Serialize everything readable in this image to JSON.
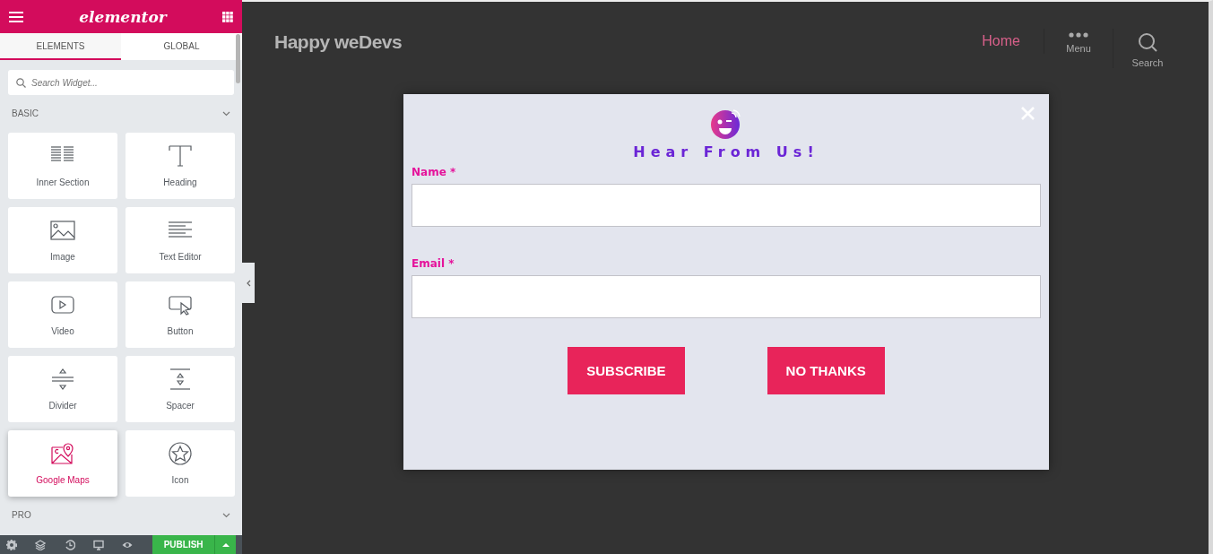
{
  "sidebar": {
    "logo": "elementor",
    "tabs": [
      {
        "label": "ELEMENTS",
        "selected": true
      },
      {
        "label": "GLOBAL",
        "selected": false
      }
    ],
    "search": {
      "placeholder": "Search Widget..."
    },
    "sections": [
      {
        "title": "BASIC",
        "widgets": [
          {
            "label": "Inner Section",
            "kind": "section",
            "selected": false
          },
          {
            "label": "Heading",
            "kind": "heading",
            "selected": false
          },
          {
            "label": "Image",
            "kind": "image",
            "selected": false
          },
          {
            "label": "Text Editor",
            "kind": "text",
            "selected": false
          },
          {
            "label": "Video",
            "kind": "video",
            "selected": false
          },
          {
            "label": "Button",
            "kind": "button",
            "selected": false
          },
          {
            "label": "Divider",
            "kind": "divider",
            "selected": false
          },
          {
            "label": "Spacer",
            "kind": "spacer",
            "selected": false
          },
          {
            "label": "Google Maps",
            "kind": "map",
            "selected": true
          },
          {
            "label": "Icon",
            "kind": "icon",
            "selected": false
          }
        ]
      },
      {
        "title": "PRO"
      }
    ],
    "footer": {
      "publish": "PUBLISH"
    }
  },
  "site": {
    "title": "Happy weDevs",
    "nav": [
      {
        "label": "Home",
        "kind": "link"
      },
      {
        "label": "Menu",
        "kind": "menu"
      },
      {
        "label": "Search",
        "kind": "search"
      }
    ]
  },
  "popup": {
    "title": "Hear From Us!",
    "fields": [
      {
        "label": "Name",
        "required_mark": "*"
      },
      {
        "label": "Email",
        "required_mark": "*"
      }
    ],
    "buttons": [
      "SUBSCRIBE",
      "NO THANKS"
    ]
  }
}
